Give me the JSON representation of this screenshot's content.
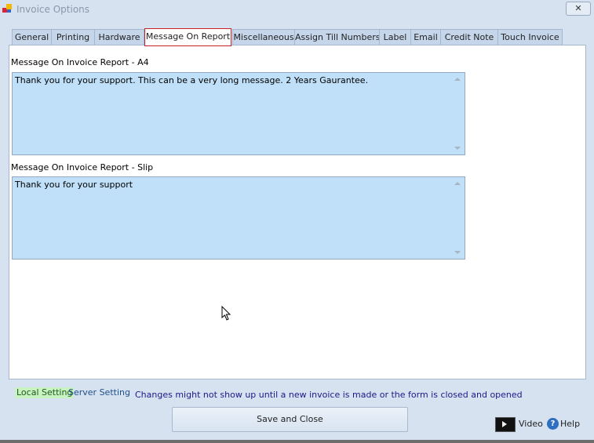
{
  "window": {
    "title": "Invoice Options",
    "close_label": "✕"
  },
  "tabs": [
    {
      "label": "General",
      "active": false
    },
    {
      "label": "Printing",
      "active": false
    },
    {
      "label": "Hardware",
      "active": false
    },
    {
      "label": "Message On Report",
      "active": true
    },
    {
      "label": "Miscellaneous",
      "active": false
    },
    {
      "label": "Assign Till Numbers",
      "active": false
    },
    {
      "label": "Label",
      "active": false
    },
    {
      "label": "Email",
      "active": false
    },
    {
      "label": "Credit Note",
      "active": false
    },
    {
      "label": "Touch Invoice",
      "active": false
    }
  ],
  "panel": {
    "a4_label": "Message On Invoice Report - A4",
    "a4_value": "Thank you for your support. This can be a very long message. 2 Years Gaurantee.",
    "slip_label": "Message On Invoice Report - Slip",
    "slip_value": "Thank you for your support"
  },
  "footer": {
    "local_setting": "Local Setting",
    "server_setting": "Server Setting",
    "note": "Changes might not show up until a new invoice is made or the form is closed and opened",
    "save_label": "Save and Close",
    "video_label": "Video",
    "help_label": "Help"
  },
  "colors": {
    "active_tab_border": "#c8202a",
    "textarea_bg": "#bfe0f8",
    "local_bg": "#c8f3c0",
    "note": "#1a1a8a"
  }
}
